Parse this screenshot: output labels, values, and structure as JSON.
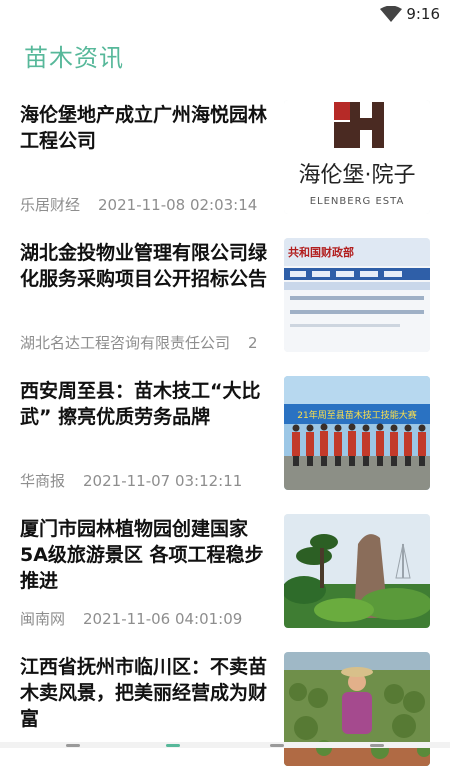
{
  "status_bar": {
    "time": "9:16"
  },
  "page": {
    "title": "苗木资讯"
  },
  "news": [
    {
      "headline": "海伦堡地产成立广州海悦园林工程公司",
      "source": "乐居财经",
      "date": "2021-11-08 02:03:14",
      "thumb_text": "海伦堡·院子",
      "thumb_subtext": "ELENBERG ESTA"
    },
    {
      "headline": "湖北金投物业管理有限公司绿化服务采购项目公开招标公告",
      "source": "湖北名达工程咨询有限责任公司",
      "date": "2",
      "thumb_text": "共和国财政部"
    },
    {
      "headline": "西安周至县：苗木技工“大比武” 擦亮优质劳务品牌",
      "source": "华商报",
      "date": "2021-11-07 03:12:11",
      "thumb_text": "21年周至县苗木技工技能大赛"
    },
    {
      "headline": "厦门市园林植物园创建国家5A级旅游景区 各项工程稳步推进",
      "source": "闽南网",
      "date": "2021-11-06 04:01:09"
    },
    {
      "headline": "江西省抚州市临川区：不卖苗木卖风景，把美丽经营成为财富",
      "source": "",
      "date": ""
    }
  ],
  "colors": {
    "accent": "#57b89a"
  },
  "icons": {
    "wifi": "wifi-icon"
  }
}
